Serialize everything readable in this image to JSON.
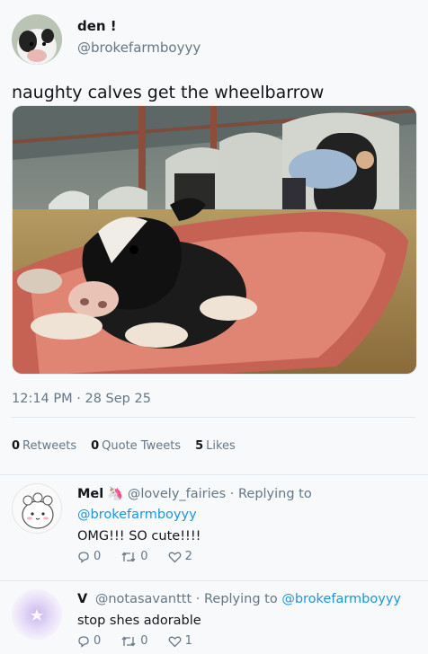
{
  "tweet": {
    "display_name": "den !",
    "handle": "@brokefarmboyyy",
    "text": "naughty calves get the wheelbarrow",
    "timestamp": "12:14 PM · 28 Sep 25",
    "retweets": "0",
    "retweets_label": "Retweets",
    "quotes": "0",
    "quotes_label": "Quote Tweets",
    "likes": "5",
    "likes_label": "Likes"
  },
  "replies": [
    {
      "name": "Mel",
      "emoji": "🦄",
      "handle": "@lovely_fairies",
      "replying_prefix": "· Replying to",
      "replying_to": "@brokefarmboyyy",
      "text": "OMG!!! SO cute!!!!",
      "replies": "0",
      "retweets": "0",
      "likes": "2"
    },
    {
      "name": "V",
      "handle": "@notasavanttt",
      "replying_prefix": "· Replying to",
      "replying_to": "@brokefarmboyyy",
      "text": "stop shes adorable",
      "replies": "0",
      "retweets": "0",
      "likes": "1"
    }
  ],
  "colors": {
    "link": "#1b95e0",
    "muted": "#657786",
    "text": "#14171a",
    "background": "#f7f9fa"
  }
}
